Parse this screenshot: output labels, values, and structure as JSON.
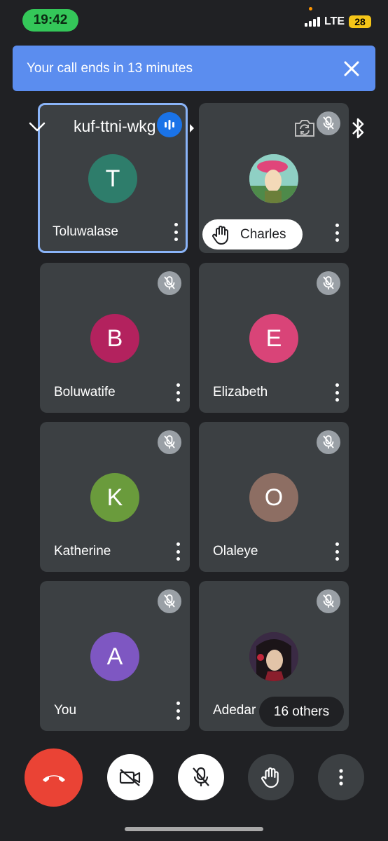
{
  "status_bar": {
    "time": "19:42",
    "network": "LTE",
    "battery": "28"
  },
  "banner": {
    "text": "Your call ends in 13 minutes",
    "close_icon": "close-icon"
  },
  "header": {
    "meeting_code": "kuf-ttni-wkg"
  },
  "participants": [
    {
      "name": "Toluwalase",
      "initial": "T",
      "color": "#2e7d6b",
      "muted": false,
      "selected": true,
      "speaking": true
    },
    {
      "name": "Charles",
      "initial": "",
      "color": "#6fb3a0",
      "muted": true,
      "hand_raised": true
    },
    {
      "name": "Boluwatife",
      "initial": "B",
      "color": "#b3225e",
      "muted": true
    },
    {
      "name": "Elizabeth",
      "initial": "E",
      "color": "#d94478",
      "muted": true
    },
    {
      "name": "Katherine",
      "initial": "K",
      "color": "#6a9b3c",
      "muted": true
    },
    {
      "name": "Olaleye",
      "initial": "O",
      "color": "#8d6e63",
      "muted": true
    },
    {
      "name": "You",
      "initial": "A",
      "color": "#7e57c2",
      "muted": true
    },
    {
      "name": "Adedar",
      "initial": "",
      "color": "#4a2a3a",
      "muted": true
    }
  ],
  "others_chip": "16 others",
  "controls": [
    {
      "name": "end-call",
      "icon": "phone-hangup-icon"
    },
    {
      "name": "camera-off",
      "icon": "video-off-icon"
    },
    {
      "name": "mic-off",
      "icon": "mic-off-icon"
    },
    {
      "name": "raise-hand",
      "icon": "hand-icon"
    },
    {
      "name": "more",
      "icon": "more-vert-icon"
    }
  ],
  "colors": {
    "background": "#202124",
    "tile": "#3c4043",
    "banner": "#5b8def",
    "end_call": "#ea4335",
    "selected_border": "#8ab4f8"
  }
}
